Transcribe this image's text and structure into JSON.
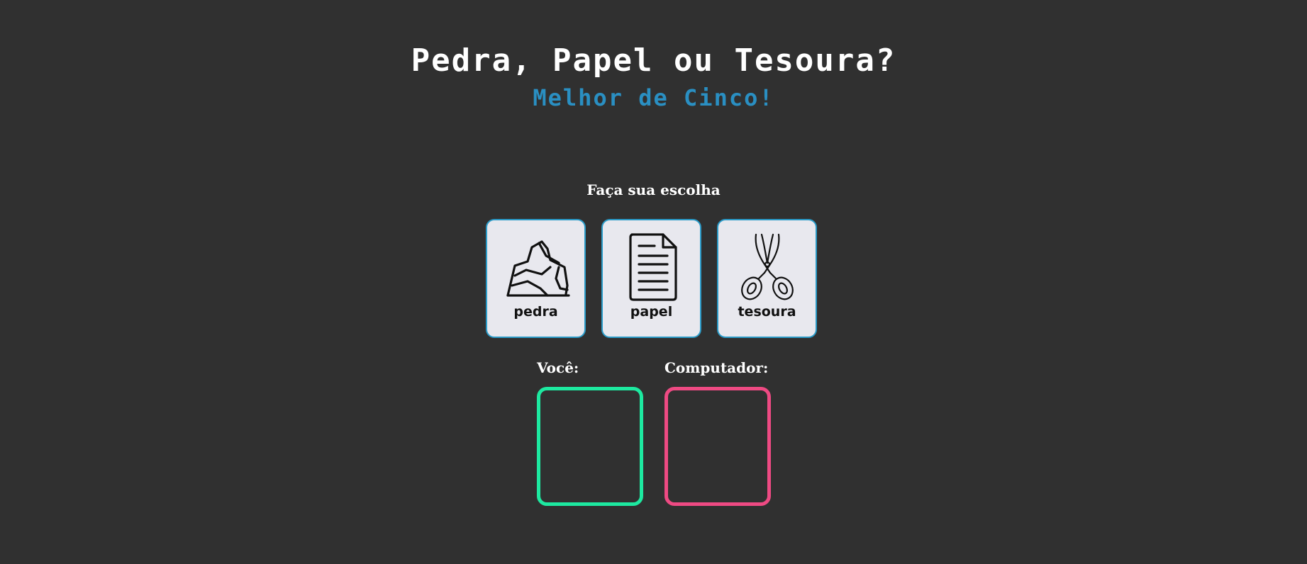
{
  "header": {
    "title": "Pedra, Papel ou Tesoura?",
    "subtitle": "Melhor de Cinco!"
  },
  "game": {
    "prompt": "Faça sua escolha",
    "choices": [
      {
        "label": "pedra",
        "icon": "rock-icon"
      },
      {
        "label": "papel",
        "icon": "paper-document-icon"
      },
      {
        "label": "tesoura",
        "icon": "scissors-icon"
      }
    ],
    "player_label": "Você:",
    "computer_label": "Computador:"
  },
  "colors": {
    "background": "#303030",
    "title": "#ffffff",
    "subtitle": "#2a8fc2",
    "choice_border": "#2a9bc8",
    "choice_bg": "#e8e8ee",
    "player_border": "#1de9a0",
    "computer_border": "#ee4a83"
  }
}
